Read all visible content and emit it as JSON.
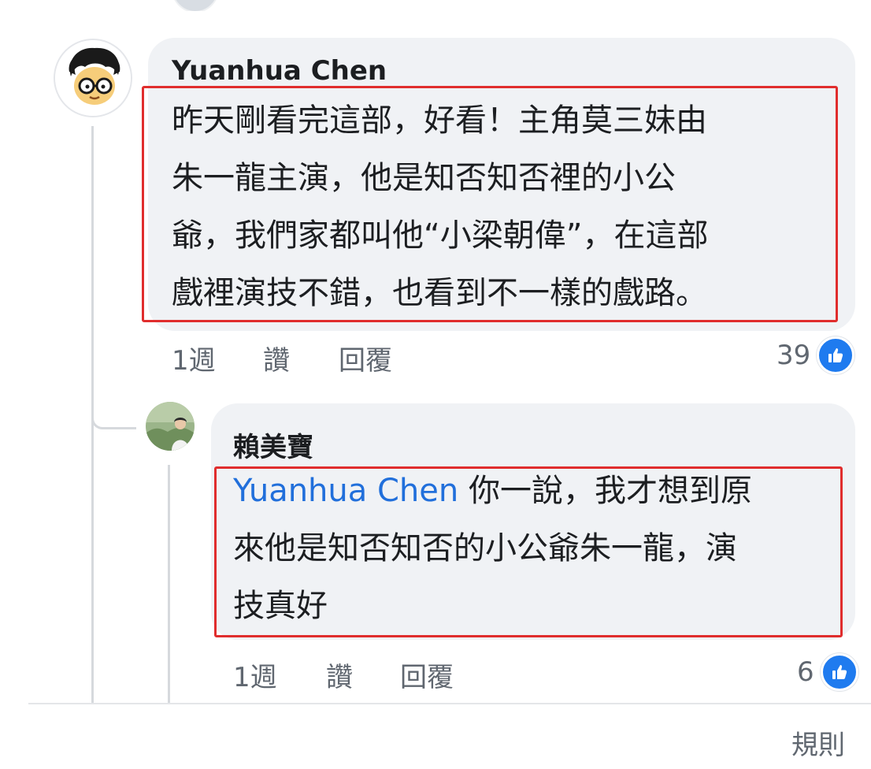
{
  "comments": [
    {
      "author": "Yuanhua Chen",
      "text_lines": [
        "昨天剛看完這部，好看！主角莫三妹由",
        "朱一龍主演，他是知否知否裡的小公",
        "爺，我們家都叫他“小梁朝偉”，在這部",
        "戲裡演技不錯，也看到不一樣的戲路。"
      ],
      "time": "1週",
      "like_label": "讚",
      "reply_label": "回覆",
      "reaction_count": "39"
    },
    {
      "author": "賴美寶",
      "mention": "Yuanhua Chen",
      "text_lines": [
        " 你一說，我才想到原",
        "來他是知否知否的小公爺朱一龍，演",
        "技真好"
      ],
      "time": "1週",
      "like_label": "讚",
      "reply_label": "回覆",
      "reaction_count": "6"
    }
  ],
  "footer": {
    "rules_label": "規則"
  },
  "colors": {
    "bubble": "#f0f2f5",
    "highlight": "#e02d2d",
    "mention": "#216fdb",
    "like_blue": "#1f7bef",
    "meta_gray": "#606770"
  }
}
